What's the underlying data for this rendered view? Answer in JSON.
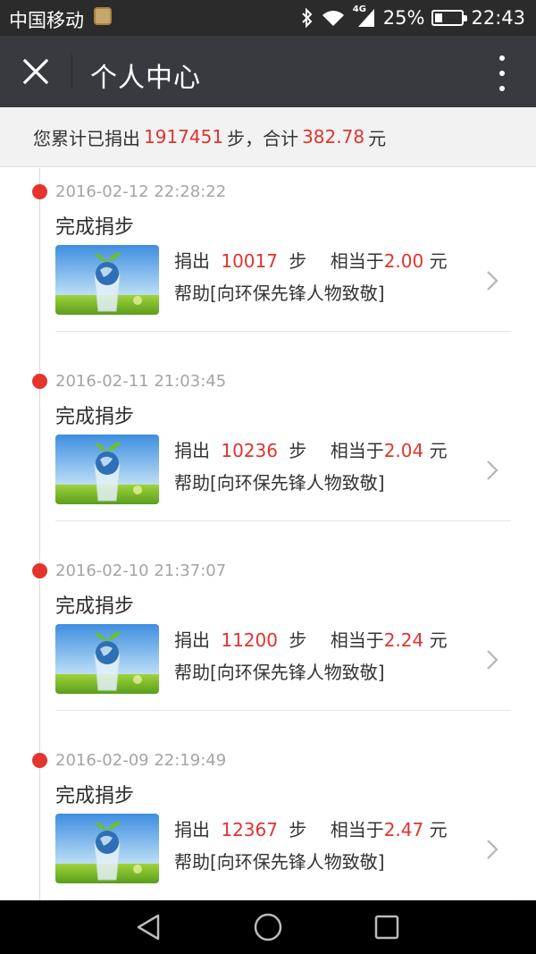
{
  "status_bar": {
    "carrier": "中国移动",
    "network": "4G",
    "battery_text": "25%",
    "battery_level": 0.25,
    "time": "22:43",
    "icons": [
      "app-notification-icon",
      "bluetooth-icon",
      "wifi-icon",
      "signal-icon",
      "battery-icon"
    ]
  },
  "header": {
    "title": "个人中心",
    "close_icon": "close-icon",
    "more_icon": "more-vertical-icon"
  },
  "summary": {
    "prefix": "您累计已捐出",
    "steps": "1917451",
    "middle": "步，合计",
    "amount": "382.78",
    "suffix": "元"
  },
  "labels": {
    "donated": "捐出",
    "steps_unit": "步",
    "equivalent": "相当于",
    "yuan": "元"
  },
  "records": [
    {
      "time": "2016-02-12 22:28:22",
      "status": "完成捐步",
      "steps": "10017",
      "amount": "2.00",
      "project": "帮助[向环保先锋人物致敬]"
    },
    {
      "time": "2016-02-11 21:03:45",
      "status": "完成捐步",
      "steps": "10236",
      "amount": "2.04",
      "project": "帮助[向环保先锋人物致敬]"
    },
    {
      "time": "2016-02-10 21:37:07",
      "status": "完成捐步",
      "steps": "11200",
      "amount": "2.24",
      "project": "帮助[向环保先锋人物致敬]"
    },
    {
      "time": "2016-02-09 22:19:49",
      "status": "完成捐步",
      "steps": "12367",
      "amount": "2.47",
      "project": "帮助[向环保先锋人物致敬]"
    }
  ],
  "nav_bar": {
    "icons": [
      "back-icon",
      "home-icon",
      "recent-apps-icon"
    ]
  },
  "colors": {
    "accent_red": "#e0342d",
    "header_bg": "#393a3f",
    "status_bg": "#2b2b2b"
  }
}
